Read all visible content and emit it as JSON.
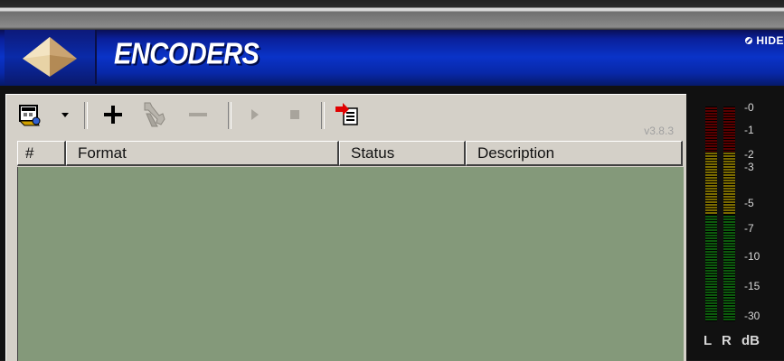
{
  "window": {
    "title": "ENCODERS",
    "hide_label": "HIDE"
  },
  "toolbar": {
    "buttons": [
      {
        "name": "configure-encoder-button",
        "icon": "encoder-settings-icon"
      },
      {
        "name": "dropdown-arrow-button",
        "icon": "chevron-down-icon"
      },
      {
        "name": "add-encoder-button",
        "icon": "plus-icon"
      },
      {
        "name": "edit-encoder-button",
        "icon": "wrench-icon"
      },
      {
        "name": "remove-encoder-button",
        "icon": "minus-icon"
      },
      {
        "name": "start-button",
        "icon": "play-icon"
      },
      {
        "name": "stop-button",
        "icon": "stop-icon"
      },
      {
        "name": "import-button",
        "icon": "import-document-icon"
      }
    ],
    "version": "v3.8.3"
  },
  "table": {
    "columns": [
      "#",
      "Format",
      "Status",
      "Description"
    ],
    "rows": []
  },
  "meter": {
    "scale": [
      "-0",
      "-1",
      "-2",
      "-3",
      "-5",
      "-7",
      "-10",
      "-15",
      "-30"
    ],
    "labels": {
      "left": "L",
      "right": "R",
      "unit": "dB"
    },
    "colors": {
      "red": "#b00000",
      "yellow": "#c8b400",
      "green": "#1a9a1a"
    }
  },
  "colors": {
    "title_blue": "#0a33c8",
    "panel_gray": "#d4d0c8",
    "list_background": "#84997a"
  }
}
